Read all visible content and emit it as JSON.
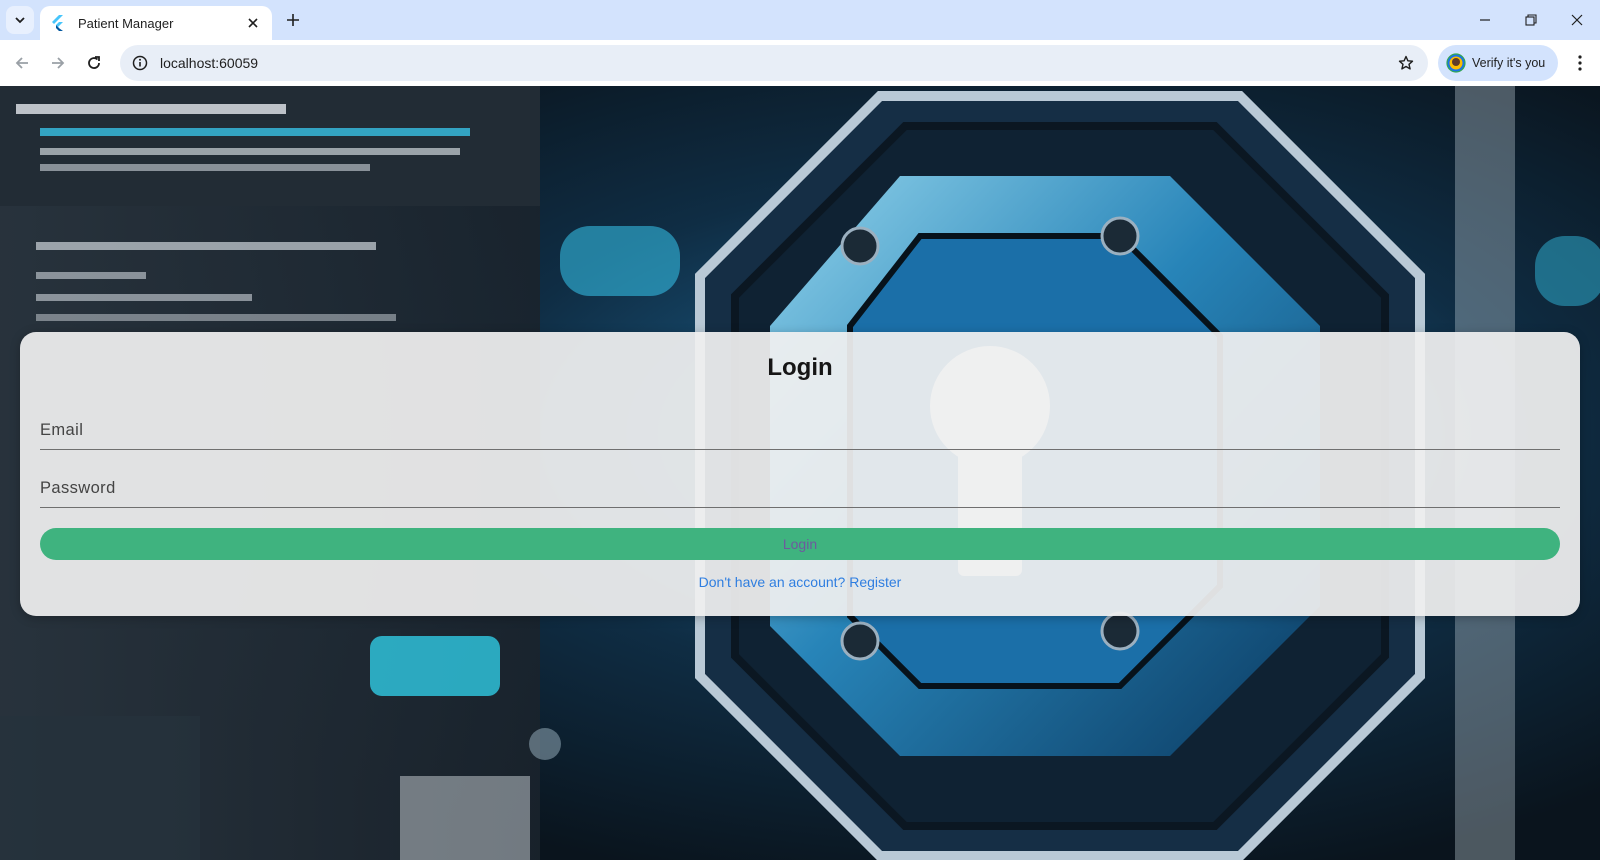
{
  "browser": {
    "tab": {
      "title": "Patient Manager"
    },
    "address": {
      "url": "localhost:60059"
    },
    "profile": {
      "label": "Verify it's you"
    }
  },
  "icons": {
    "tab_search": "chevron-down-icon",
    "favicon": "flutter-icon",
    "tab_close": "close-icon",
    "new_tab": "plus-icon",
    "back": "arrow-left-icon",
    "forward": "arrow-right-icon",
    "reload": "reload-icon",
    "site_info": "info-icon",
    "bookmark": "star-icon",
    "menu": "kebab-menu-icon",
    "minimize": "minimize-icon",
    "restore": "restore-icon",
    "close_window": "close-icon"
  },
  "login": {
    "title": "Login",
    "email_placeholder": "Email",
    "email_value": "",
    "password_placeholder": "Password",
    "password_value": "",
    "submit_label": "Login",
    "register_text": "Don't have an account? Register"
  },
  "colors": {
    "tabstrip": "#d3e3fd",
    "button": "#3fb37f",
    "button_text": "#6e5a9e",
    "link": "#2f7ee0"
  }
}
